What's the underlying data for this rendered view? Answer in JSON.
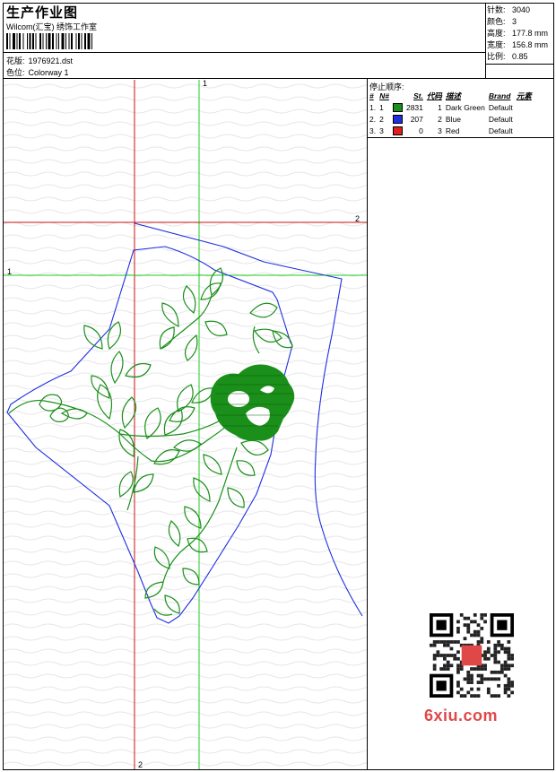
{
  "header": {
    "title": "生产作业图",
    "studio": "Wilcom(汇宝) 绣饰工作室",
    "design_label": "花版:",
    "design_value": "1976921.dst",
    "colorway_label": "色位:",
    "colorway_value": "Colorway 1"
  },
  "stats": {
    "stitches_label": "针数:",
    "stitches_value": "3040",
    "colors_label": "颜色:",
    "colors_value": "3",
    "height_label": "高度:",
    "height_value": "177.8 mm",
    "width_label": "宽度:",
    "width_value": "156.8 mm",
    "scale_label": "比例:",
    "scale_value": "0.85"
  },
  "color_panel": {
    "title": "停止顺序:",
    "headers": {
      "num": "#",
      "no": "N#",
      "st": "St.",
      "code": "代码",
      "desc": "描述",
      "brand": "Brand",
      "element": "元素"
    },
    "rows": [
      {
        "num": "1.",
        "no": "1",
        "color": "#1a8f1a",
        "st": "2831",
        "code": "1",
        "desc": "Dark Green",
        "brand": "Default"
      },
      {
        "num": "2.",
        "no": "2",
        "color": "#1e2ee0",
        "st": "207",
        "code": "2",
        "desc": "Blue",
        "brand": "Default"
      },
      {
        "num": "3.",
        "no": "3",
        "color": "#e01e1e",
        "st": "0",
        "code": "3",
        "desc": "Red",
        "brand": "Default"
      }
    ]
  },
  "guides": {
    "green_v_label": "1",
    "green_h_label": "1",
    "red_h_label": "2",
    "red_v_label": "2"
  },
  "watermark": {
    "text": "6xiu.com"
  },
  "colors": {
    "guide_green": "#22cc22",
    "guide_red": "#cc1111",
    "outline_blue": "#1e2ee0",
    "stitch_green": "#1a8f1a"
  }
}
